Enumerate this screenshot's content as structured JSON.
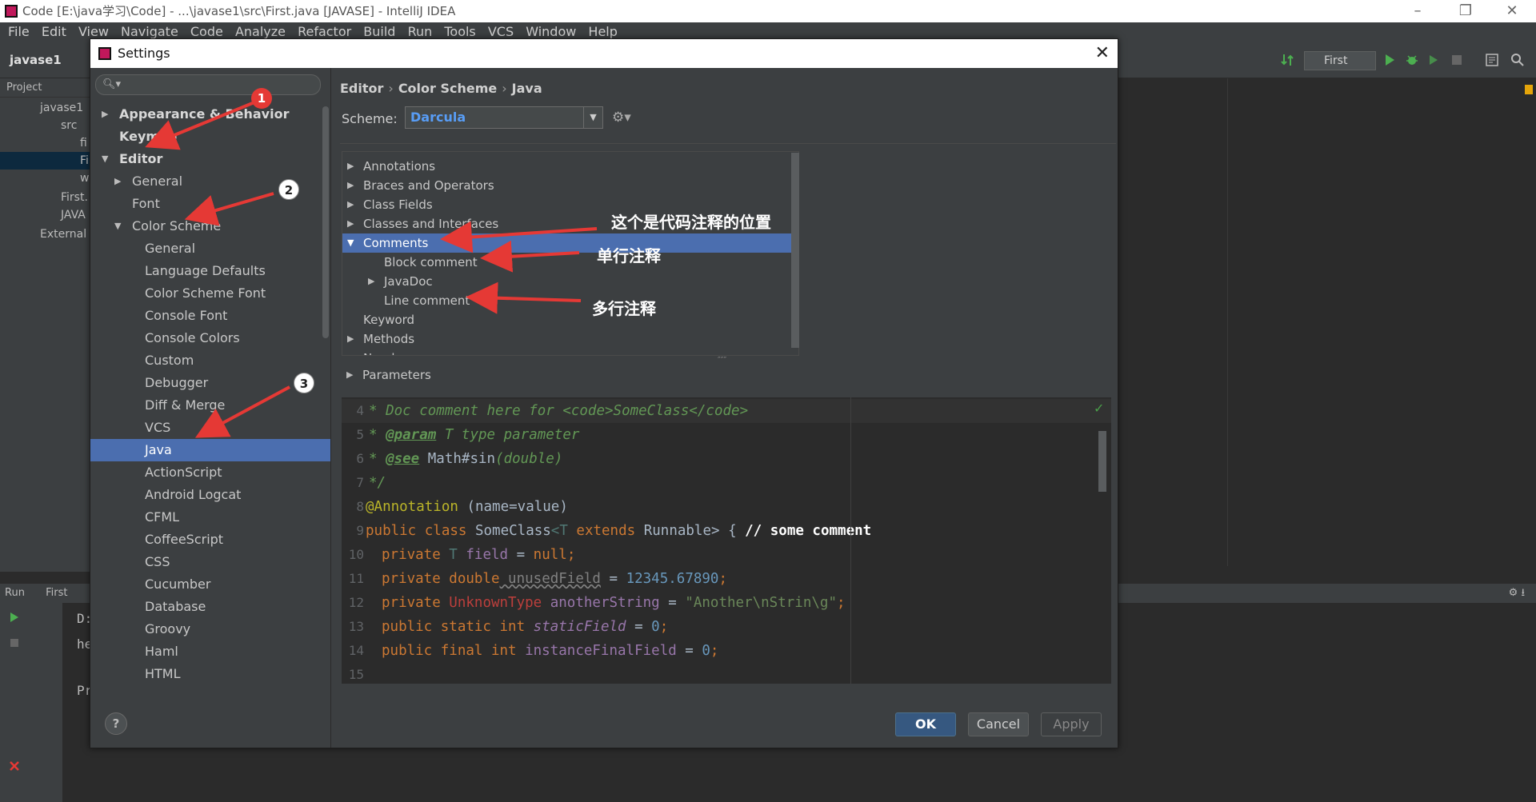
{
  "window": {
    "title": "Code [E:\\java学习\\Code] - ...\\javase1\\src\\First.java [JAVASE] - IntelliJ IDEA"
  },
  "menu": [
    "File",
    "Edit",
    "View",
    "Navigate",
    "Code",
    "Analyze",
    "Refactor",
    "Build",
    "Run",
    "Tools",
    "VCS",
    "Window",
    "Help"
  ],
  "navbar": {
    "project": "javase1",
    "run_config": "First"
  },
  "project_panel": {
    "header": "Project",
    "items": [
      "javase1",
      "src",
      "fi",
      "Fi",
      "w",
      "First.",
      "JAVA",
      "External"
    ]
  },
  "run_panel": {
    "header": "Run",
    "config": "First",
    "lines": [
      "D:",
      "he",
      "Pr"
    ]
  },
  "dialog": {
    "title": "Settings",
    "search_placeholder": "",
    "breadcrumb": [
      "Editor",
      "Color Scheme",
      "Java"
    ],
    "scheme_label": "Scheme:",
    "scheme_value": "Darcula",
    "tree": {
      "appearance": "Appearance & Behavior",
      "keymap": "Keymap",
      "editor": "Editor",
      "general": "General",
      "font": "Font",
      "color_scheme": "Color Scheme",
      "cs_items": [
        "General",
        "Language Defaults",
        "Color Scheme Font",
        "Console Font",
        "Console Colors",
        "Custom",
        "Debugger",
        "Diff & Merge",
        "VCS",
        "Java",
        "ActionScript",
        "Android Logcat",
        "CFML",
        "CoffeeScript",
        "CSS",
        "Cucumber",
        "Database",
        "Groovy",
        "Haml",
        "HTML"
      ]
    },
    "attributes": {
      "annotations": "Annotations",
      "braces": "Braces and Operators",
      "class_fields": "Class Fields",
      "classes": "Classes and Interfaces",
      "comments": "Comments",
      "block_comment": "Block comment",
      "javadoc": "JavaDoc",
      "line_comment": "Line comment",
      "keyword": "Keyword",
      "methods": "Methods",
      "number": "Number",
      "parameters": "Parameters"
    },
    "preview": {
      "line_numbers": [
        "4",
        "5",
        "6",
        "7",
        "8",
        "9",
        "10",
        "11",
        "12",
        "13",
        "14",
        "15"
      ],
      "l4": "* Doc comment here for <code>SomeClass</code>",
      "l5_star": "* ",
      "l5_tag": "@param",
      "l5_rest": " T type parameter",
      "l6_star": "* ",
      "l6_tag": "@see",
      "l6_rest": " Math#sin",
      "l6_paren": "(double)",
      "l7": "*/",
      "l8_ann": "@Annotation",
      "l8_rest": " (name=value)",
      "l9_kw": "public class",
      "l9_cls": " SomeClass",
      "l9_tp": "<T",
      "l9_kw2": " extends",
      "l9_rest": " Runnable> { ",
      "l9_cmt": "// some comment",
      "l10_kw": "private",
      "l10_tp": " T",
      "l10_fld": " field",
      "l10_rest": " = ",
      "l10_null": "null;",
      "l11_kw": "private double",
      "l11_fld": " unusedField",
      "l11_rest": " = ",
      "l11_num": "12345.67890",
      "l11_end": ";",
      "l12_kw": "private",
      "l12_err": " UnknownType",
      "l12_fld": " anotherString",
      "l12_rest": " = ",
      "l12_str": "\"Another\\nStrin\\g\"",
      "l12_end": ";",
      "l13_kw": "public static int",
      "l13_fld": " staticField",
      "l13_rest": " = ",
      "l13_num": "0",
      "l13_end": ";",
      "l14_kw": "public final int",
      "l14_fld": " instanceFinalField",
      "l14_rest": " = ",
      "l14_num": "0",
      "l14_end": ";"
    },
    "buttons": {
      "help": "?",
      "ok": "OK",
      "cancel": "Cancel",
      "apply": "Apply"
    }
  },
  "annotations": {
    "badges": [
      "1",
      "2",
      "3"
    ],
    "note_comments": "这个是代码注释的位置",
    "note_block": "单行注释",
    "note_line": "多行注释"
  },
  "colors": {
    "selection": "#4b6eaf",
    "dialog_bg": "#3c3f41",
    "editor_bg": "#2b2b2b",
    "arrow_red": "#e53935",
    "scheme_value": "#589df6"
  }
}
